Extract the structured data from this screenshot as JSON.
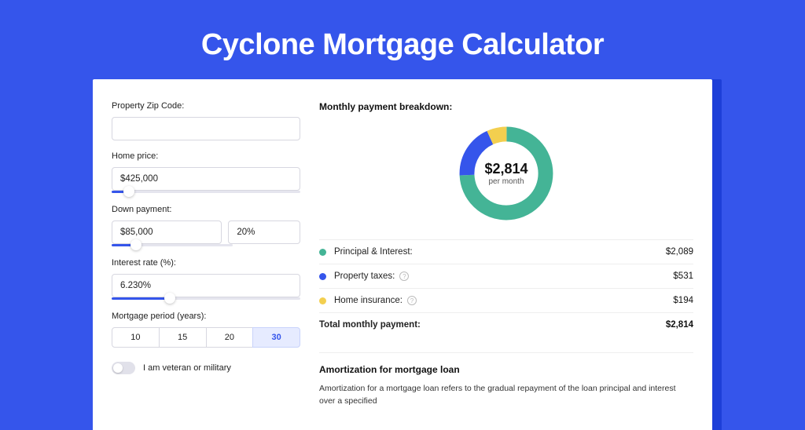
{
  "page_title": "Cyclone Mortgage Calculator",
  "colors": {
    "principal": "#44b496",
    "taxes": "#3555eb",
    "insurance": "#f3cf4f"
  },
  "form": {
    "zip_label": "Property Zip Code:",
    "zip_value": "",
    "home_price_label": "Home price:",
    "home_price_value": "$425,000",
    "home_price_slider_pct": 9,
    "down_label": "Down payment:",
    "down_amount": "$85,000",
    "down_pct": "20%",
    "down_slider_pct": 20,
    "rate_label": "Interest rate (%):",
    "rate_value": "6.230%",
    "rate_slider_pct": 31,
    "period_label": "Mortgage period (years):",
    "periods": [
      "10",
      "15",
      "20",
      "30"
    ],
    "period_active": "30",
    "veteran_label": "I am veteran or military",
    "veteran_on": false
  },
  "breakdown": {
    "title": "Monthly payment breakdown:",
    "center_value": "$2,814",
    "center_sub": "per month",
    "items": [
      {
        "label": "Principal & Interest:",
        "value": "$2,089",
        "color_key": "principal",
        "has_info": false
      },
      {
        "label": "Property taxes:",
        "value": "$531",
        "color_key": "taxes",
        "has_info": true
      },
      {
        "label": "Home insurance:",
        "value": "$194",
        "color_key": "insurance",
        "has_info": true
      }
    ],
    "total_label": "Total monthly payment:",
    "total_value": "$2,814"
  },
  "chart_data": {
    "type": "pie",
    "title": "Monthly payment breakdown",
    "categories": [
      "Principal & Interest",
      "Property taxes",
      "Home insurance"
    ],
    "values": [
      2089,
      531,
      194
    ],
    "total": 2814
  },
  "amortization": {
    "title": "Amortization for mortgage loan",
    "body": "Amortization for a mortgage loan refers to the gradual repayment of the loan principal and interest over a specified"
  }
}
